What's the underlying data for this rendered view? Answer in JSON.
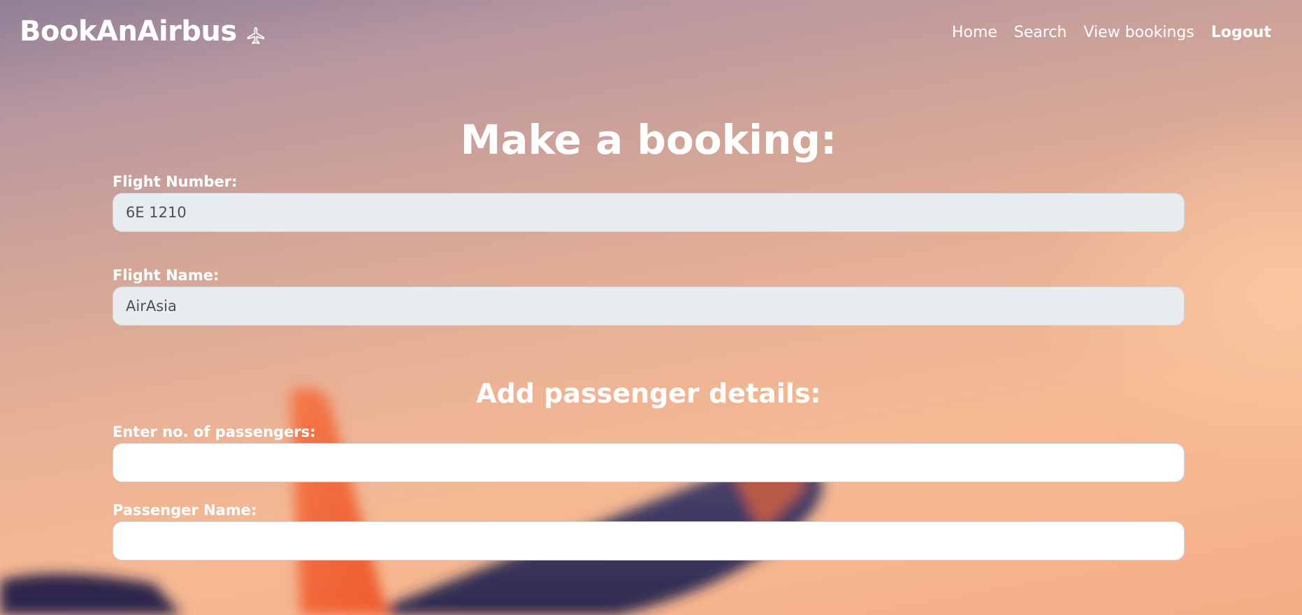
{
  "nav": {
    "brand": "BookAnAirbus",
    "links": [
      "Home",
      "Search",
      "View bookings",
      "Logout"
    ]
  },
  "form": {
    "title": "Make a booking:",
    "flight_number": {
      "label": "Flight Number:",
      "value": "6E 1210"
    },
    "flight_name": {
      "label": "Flight Name:",
      "value": "AirAsia"
    },
    "passenger_section_title": "Add passenger details:",
    "num_passengers": {
      "label": "Enter no. of passengers:",
      "value": ""
    },
    "passenger_name": {
      "label": "Passenger Name:",
      "value": ""
    }
  },
  "icons": {
    "brand": "airplane-icon"
  },
  "colors": {
    "text": "#ffffff",
    "input_readonly_bg": "#e9ecef",
    "input_bg": "#ffffff",
    "input_text": "#495057"
  }
}
